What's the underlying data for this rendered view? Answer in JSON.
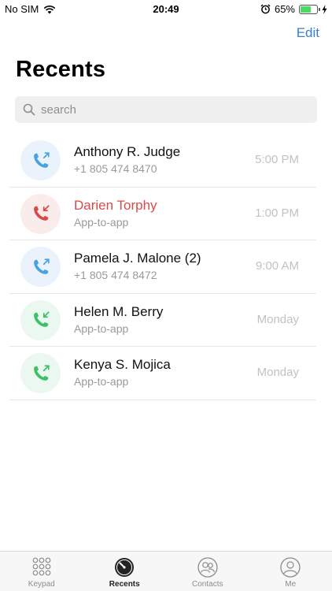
{
  "status_bar": {
    "carrier": "No SIM",
    "time": "20:49",
    "battery_percent": "65%",
    "battery_level": 0.65
  },
  "header": {
    "edit_label": "Edit",
    "title": "Recents"
  },
  "search": {
    "placeholder": "search"
  },
  "recents": [
    {
      "name": "Anthony R. Judge",
      "subtitle": "+1 805 474 8470",
      "time": "5:00 PM",
      "call_type": "outgoing",
      "color": "#4aa3df",
      "bg": "#eaf3fb"
    },
    {
      "name": "Darien Torphy",
      "subtitle": "App-to-app",
      "time": "1:00 PM",
      "call_type": "missed",
      "color": "#d84a4a",
      "bg": "#fbecec"
    },
    {
      "name": "Pamela J. Malone (2)",
      "subtitle": "+1 805 474 8472",
      "time": "9:00 AM",
      "call_type": "outgoing",
      "color": "#4aa3df",
      "bg": "#eaf3fb"
    },
    {
      "name": "Helen M. Berry",
      "subtitle": "App-to-app",
      "time": "Monday",
      "call_type": "incoming",
      "color": "#3cc16a",
      "bg": "#eaf8ef"
    },
    {
      "name": "Kenya S. Mojica",
      "subtitle": "App-to-app",
      "time": "Monday",
      "call_type": "outgoing",
      "color": "#3cc16a",
      "bg": "#eaf8ef"
    }
  ],
  "tab_bar": {
    "tabs": [
      {
        "label": "Keypad",
        "icon": "keypad-icon",
        "active": false
      },
      {
        "label": "Recents",
        "icon": "clock-icon",
        "active": true
      },
      {
        "label": "Contacts",
        "icon": "contacts-icon",
        "active": false
      },
      {
        "label": "Me",
        "icon": "person-icon",
        "active": false
      }
    ]
  }
}
